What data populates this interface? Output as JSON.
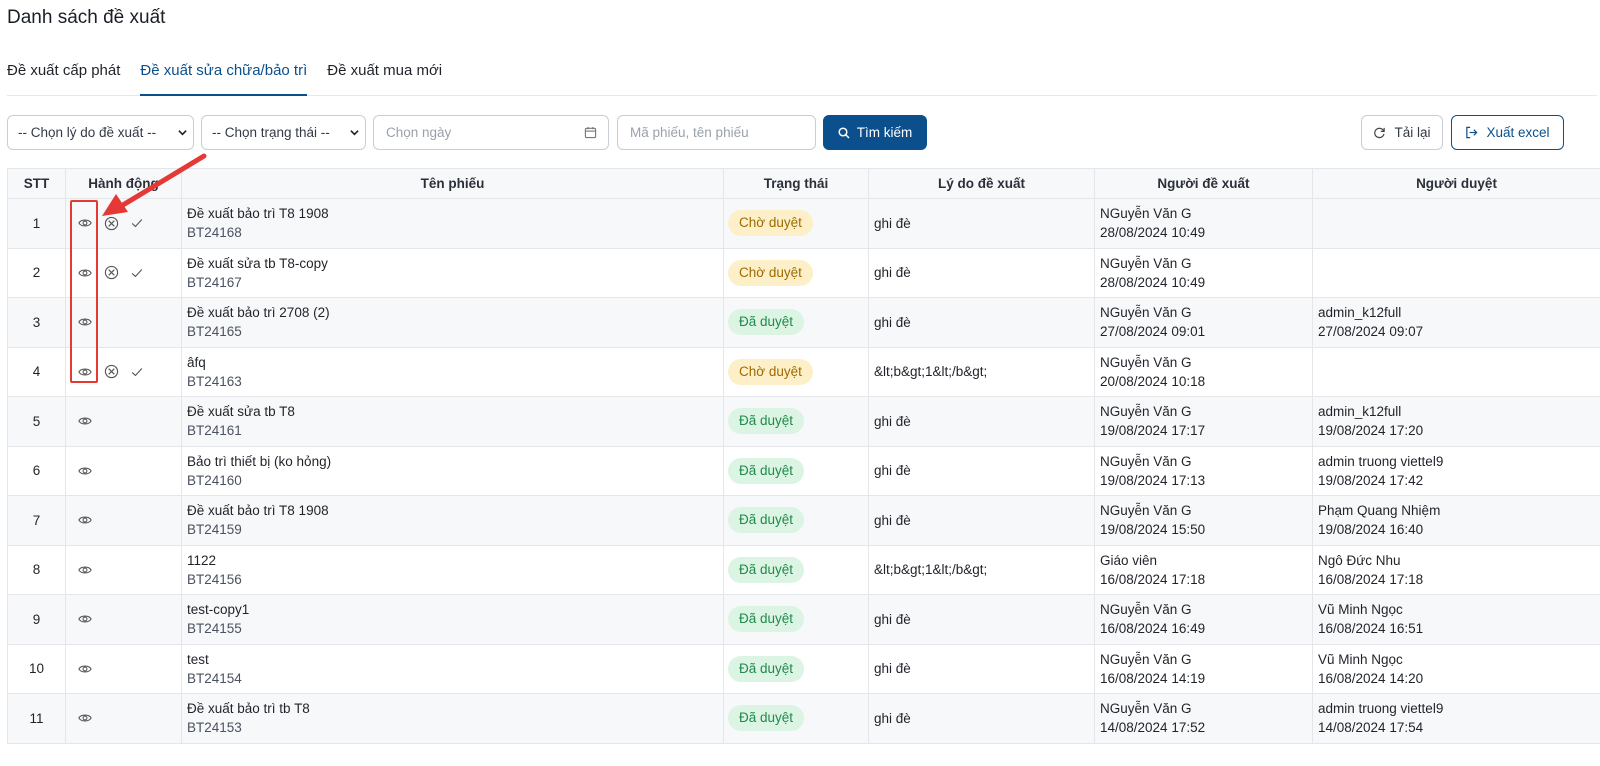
{
  "page_title": "Danh sách đề xuất",
  "tabs": [
    {
      "label": "Đề xuất cấp phát",
      "active": false
    },
    {
      "label": "Đề xuất sửa chữa/bảo trì",
      "active": true
    },
    {
      "label": "Đề xuất mua mới",
      "active": false
    }
  ],
  "filters": {
    "reason_select": "-- Chọn lý do đề xuất --",
    "status_select": "-- Chọn trạng thái --",
    "date_placeholder": "Chọn ngày",
    "code_placeholder": "Mã phiếu, tên phiếu",
    "search_label": "Tìm kiếm"
  },
  "toolbar": {
    "reload_label": "Tải lại",
    "export_label": "Xuất excel"
  },
  "colors": {
    "primary": "#0b4f8c",
    "pending_bg": "#fdf0c8",
    "pending_text": "#a06a00",
    "approved_bg": "#dcf4e3",
    "approved_text": "#1f8a4b",
    "annotation": "#e53935"
  },
  "columns": [
    "STT",
    "Hành động",
    "Tên phiếu",
    "Trạng thái",
    "Lý do đề xuất",
    "Người đề xuất",
    "Người duyệt"
  ],
  "rows": [
    {
      "stt": "1",
      "actions": [
        "eye-icon",
        "reject-icon",
        "approve-icon"
      ],
      "name": "Đề xuất bảo trì T8 1908",
      "code": "BT24168",
      "status": "Chờ duyệt",
      "status_type": "pending",
      "reason": "ghi đè",
      "proposer": "NGuyễn Văn G",
      "proposed_at": "28/08/2024 10:49",
      "approver": "",
      "approved_at": ""
    },
    {
      "stt": "2",
      "actions": [
        "eye-icon",
        "reject-icon",
        "approve-icon"
      ],
      "name": "Đề xuất sửa tb T8-copy",
      "code": "BT24167",
      "status": "Chờ duyệt",
      "status_type": "pending",
      "reason": "ghi đè",
      "proposer": "NGuyễn Văn G",
      "proposed_at": "28/08/2024 10:49",
      "approver": "",
      "approved_at": ""
    },
    {
      "stt": "3",
      "actions": [
        "eye-icon"
      ],
      "name": "Đề xuất bảo trì 2708 (2)",
      "code": "BT24165",
      "status": "Đã duyệt",
      "status_type": "approved",
      "reason": "ghi đè",
      "proposer": "NGuyễn Văn G",
      "proposed_at": "27/08/2024 09:01",
      "approver": "admin_k12full",
      "approved_at": "27/08/2024 09:07"
    },
    {
      "stt": "4",
      "actions": [
        "eye-icon",
        "reject-icon",
        "approve-icon"
      ],
      "name": "âfq",
      "code": "BT24163",
      "status": "Chờ duyệt",
      "status_type": "pending",
      "reason": "&lt;b&gt;1&lt;/b&gt;",
      "proposer": "NGuyễn Văn G",
      "proposed_at": "20/08/2024 10:18",
      "approver": "",
      "approved_at": ""
    },
    {
      "stt": "5",
      "actions": [
        "eye-icon"
      ],
      "name": "Đề xuất sửa tb T8",
      "code": "BT24161",
      "status": "Đã duyệt",
      "status_type": "approved",
      "reason": "ghi đè",
      "proposer": "NGuyễn Văn G",
      "proposed_at": "19/08/2024 17:17",
      "approver": "admin_k12full",
      "approved_at": "19/08/2024 17:20"
    },
    {
      "stt": "6",
      "actions": [
        "eye-icon"
      ],
      "name": "Bảo trì thiết bị (ko hỏng)",
      "code": "BT24160",
      "status": "Đã duyệt",
      "status_type": "approved",
      "reason": "ghi đè",
      "proposer": "NGuyễn Văn G",
      "proposed_at": "19/08/2024 17:13",
      "approver": "admin truong viettel9",
      "approved_at": "19/08/2024 17:42"
    },
    {
      "stt": "7",
      "actions": [
        "eye-icon"
      ],
      "name": "Đề xuất bảo trì T8 1908",
      "code": "BT24159",
      "status": "Đã duyệt",
      "status_type": "approved",
      "reason": "ghi đè",
      "proposer": "NGuyễn Văn G",
      "proposed_at": "19/08/2024 15:50",
      "approver": "Phạm Quang Nhiệm",
      "approved_at": "19/08/2024 16:40"
    },
    {
      "stt": "8",
      "actions": [
        "eye-icon"
      ],
      "name": "1122",
      "code": "BT24156",
      "status": "Đã duyệt",
      "status_type": "approved",
      "reason": "&lt;b&gt;1&lt;/b&gt;",
      "proposer": "Giáo viên",
      "proposed_at": "16/08/2024 17:18",
      "approver": "Ngô Đức Nhu",
      "approved_at": "16/08/2024 17:18"
    },
    {
      "stt": "9",
      "actions": [
        "eye-icon"
      ],
      "name": "test-copy1",
      "code": "BT24155",
      "status": "Đã duyệt",
      "status_type": "approved",
      "reason": "ghi đè",
      "proposer": "NGuyễn Văn G",
      "proposed_at": "16/08/2024 16:49",
      "approver": "Vũ Minh Ngọc",
      "approved_at": "16/08/2024 16:51"
    },
    {
      "stt": "10",
      "actions": [
        "eye-icon"
      ],
      "name": "test",
      "code": "BT24154",
      "status": "Đã duyệt",
      "status_type": "approved",
      "reason": "ghi đè",
      "proposer": "NGuyễn Văn G",
      "proposed_at": "16/08/2024 14:19",
      "approver": "Vũ Minh Ngọc",
      "approved_at": "16/08/2024 14:20"
    },
    {
      "stt": "11",
      "actions": [
        "eye-icon"
      ],
      "name": "Đề xuất bảo trì tb T8",
      "code": "BT24153",
      "status": "Đã duyệt",
      "status_type": "approved",
      "reason": "ghi đè",
      "proposer": "NGuyễn Văn G",
      "proposed_at": "14/08/2024 17:52",
      "approver": "admin truong viettel9",
      "approved_at": "14/08/2024 17:54"
    }
  ]
}
